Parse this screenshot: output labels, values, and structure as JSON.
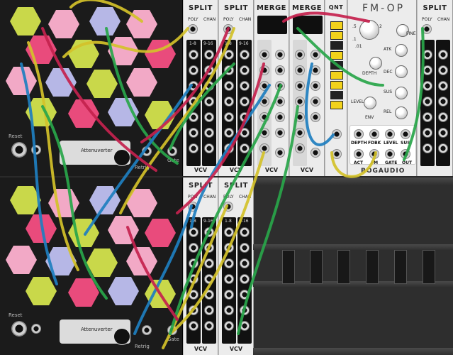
{
  "split_module": {
    "title": "SPLIT",
    "poly_label": "POLY",
    "chan_label": "CHAN",
    "range_a": "1-8",
    "range_b": "9-16",
    "footer": "VCV"
  },
  "merge_module": {
    "title": "MERGE",
    "footer": "VCV"
  },
  "quantizer": {
    "title": "QNT"
  },
  "fm_op": {
    "title": "FM-OP",
    "brand": "BOGAUDIO",
    "knob_labels": [
      "DEPTH",
      "ATK",
      "FINE",
      "DEC",
      "SUS",
      "REL",
      "LEVEL",
      "ENV"
    ],
    "jack_labels": [
      "DEPTH",
      "FDBK",
      "LEVEL",
      "SUS",
      "ACT",
      "FM",
      "GATE",
      "OUT"
    ],
    "scale_labels": [
      ".5",
      "2",
      ".1",
      ".01"
    ]
  },
  "sequencer_module": {
    "reset_label": "Reset",
    "attenuverter_label": "Attenuverter",
    "retrig_label": "Retrig",
    "gate_label": "Gate"
  },
  "colors": {
    "cable_yellow": "#d4c22a",
    "cable_green": "#29a64a",
    "cable_blue": "#1f7fc0",
    "cable_red": "#c5224e",
    "panel_dark": "#1b1b1b",
    "panel_light": "#ececec"
  }
}
